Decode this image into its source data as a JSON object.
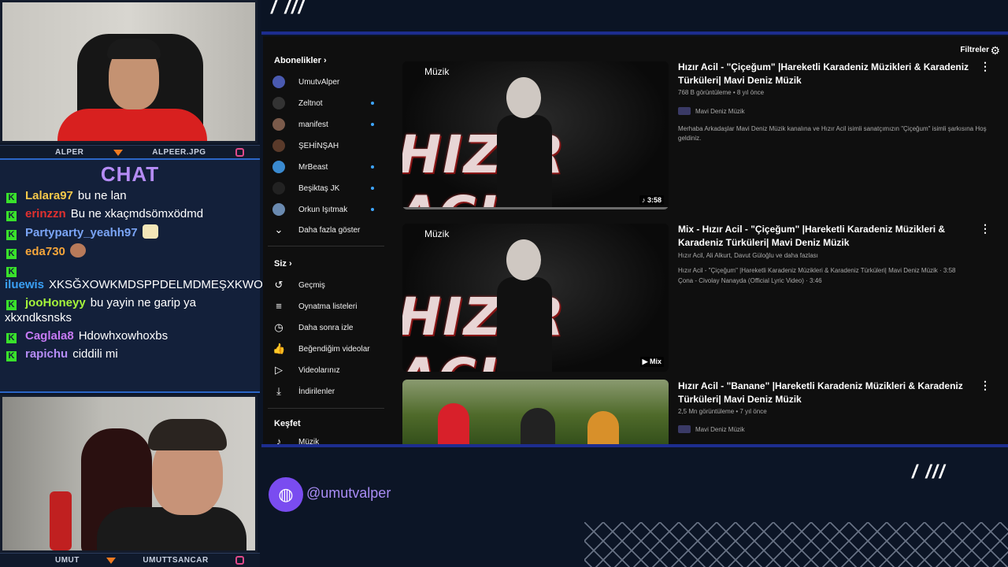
{
  "overlay": {
    "cam_top_left_label": "ALPER",
    "cam_top_right_label": "ALPEER.JPG",
    "cam_bottom_left_label": "UMUT",
    "cam_bottom_right_label": "UMUTTSANCAR",
    "chat_title": "CHAT",
    "handle": "@umutvalper",
    "slashes": "/ ///"
  },
  "chat": [
    {
      "user": "Lalara97",
      "color": "#f5c84a",
      "text": "bu ne lan"
    },
    {
      "user": "erinzzn",
      "color": "#e0302f",
      "text": "Bu ne xkaçmdsömxödmd"
    },
    {
      "user": "Partyparty_yeahh97",
      "color": "#7aa4f5",
      "text": ""
    },
    {
      "user": "eda730",
      "color": "#f5a53a",
      "text": ""
    },
    {
      "user": "iluewis",
      "color": "#3aa0f5",
      "text": "XKSĞXOWKMDSPPDELMDMEŞXKWOD"
    },
    {
      "user": "jooHoneyy",
      "color": "#a6f53a",
      "text": "bu yayin ne garip ya xkxndksnsks"
    },
    {
      "user": "Caglala8",
      "color": "#c77af5",
      "text": "Hdowhxowhoxbs"
    },
    {
      "user": "rapichu",
      "color": "#b58cf5",
      "text": "ciddili mi"
    }
  ],
  "sidebar": {
    "subs_header": "Abonelikler",
    "subs": [
      {
        "label": "UmutvAlper",
        "dot": false
      },
      {
        "label": "Zeltnot",
        "dot": true
      },
      {
        "label": "manifest",
        "dot": true
      },
      {
        "label": "ŞEHİNŞAH",
        "dot": false
      },
      {
        "label": "MrBeast",
        "dot": true
      },
      {
        "label": "Beşiktaş JK",
        "dot": true
      },
      {
        "label": "Orkun Işıtmak",
        "dot": true
      }
    ],
    "show_more": "Daha fazla göster",
    "you_header": "Siz",
    "you_items": [
      "Geçmiş",
      "Oynatma listeleri",
      "Daha sonra izle",
      "Beğendiğim videolar",
      "Videolarınız",
      "İndirilenler"
    ],
    "explore_header": "Keşfet",
    "explore_items": [
      "Müzik"
    ]
  },
  "filters_label": "Filtreler",
  "videos": [
    {
      "title": "Hızır Acil - \"Çiçeğum\" |Hareketli Karadeniz Müzikleri & Karadeniz Türküleri| Mavi Deniz Müzik",
      "meta": "768 B görüntüleme • 8 yıl önce",
      "channel": "Mavi Deniz Müzik",
      "desc": "Merhaba Arkadaşlar Mavi Deniz Müzik kanalına ve Hızır Acil isimli sanatçımızın \"Çiçeğum\" isimli şarkısına Hoş geldiniz.",
      "thumb_label": "Müzik",
      "duration": "♪ 3:58"
    },
    {
      "title": "Mix - Hızır Acil - \"Çiçeğum\" |Hareketli Karadeniz Müzikleri & Karadeniz Türküleri| Mavi Deniz Müzik",
      "meta": "Hızır Acil, Ali Alkurt, Davut Güloğlu ve daha fazlası",
      "line1": "Hızır Acil - \"Çiçeğum\" |Hareketli Karadeniz Müzikleri & Karadeniz Türküleri| Mavi Deniz Müzik · 3:58",
      "line2": "Çona - Civolay Nanayda (Official Lyric Video) · 3:46",
      "thumb_label": "Müzik",
      "duration": "▶ Mix"
    },
    {
      "title": "Hızır Acil - \"Banane\" |Hareketli Karadeniz Müzikleri & Karadeniz Türküleri| Mavi Deniz Müzik",
      "meta": "2,5 Mn görüntüleme • 7 yıl önce",
      "channel": "Mavi Deniz Müzik"
    }
  ],
  "thumb_sign": "HIZIR ACIL"
}
